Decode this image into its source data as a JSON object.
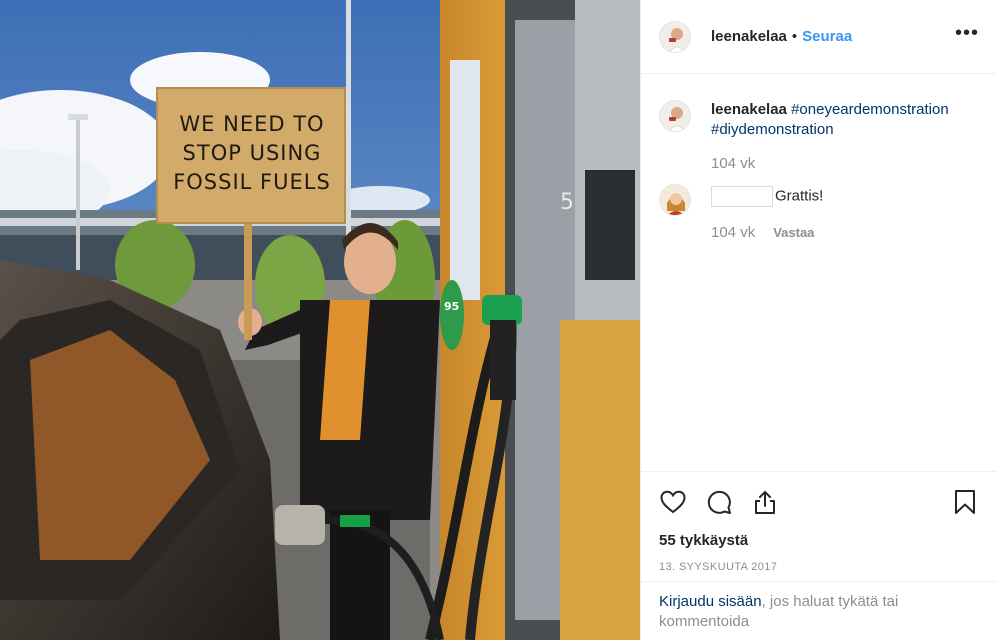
{
  "photo": {
    "sign_lines": [
      "WE NEED TO",
      "STOP USING",
      "FOSSIL FUELS"
    ],
    "pump_number": "5",
    "nozzle_label": "95"
  },
  "header": {
    "username": "leenakelaa",
    "separator": "•",
    "follow_label": "Seuraa",
    "more_label": "•••"
  },
  "caption": {
    "author": "leenakelaa",
    "hashtag_1": "#oneyeardemonstration",
    "hashtag_2": "#diydemonstration",
    "age": "104 vk"
  },
  "comment": {
    "text": "Grattis!",
    "age": "104 vk",
    "reply_label": "Vastaa"
  },
  "actions": {
    "like_icon": "heart-icon",
    "comment_icon": "comment-icon",
    "share_icon": "share-icon",
    "save_icon": "bookmark-icon"
  },
  "likes": "55 tykkäystä",
  "date": "13. SYYSKUUTA 2017",
  "login": {
    "link_text": "Kirjaudu sisään",
    "rest_text": ", jos haluat tykätä tai kommentoida"
  }
}
